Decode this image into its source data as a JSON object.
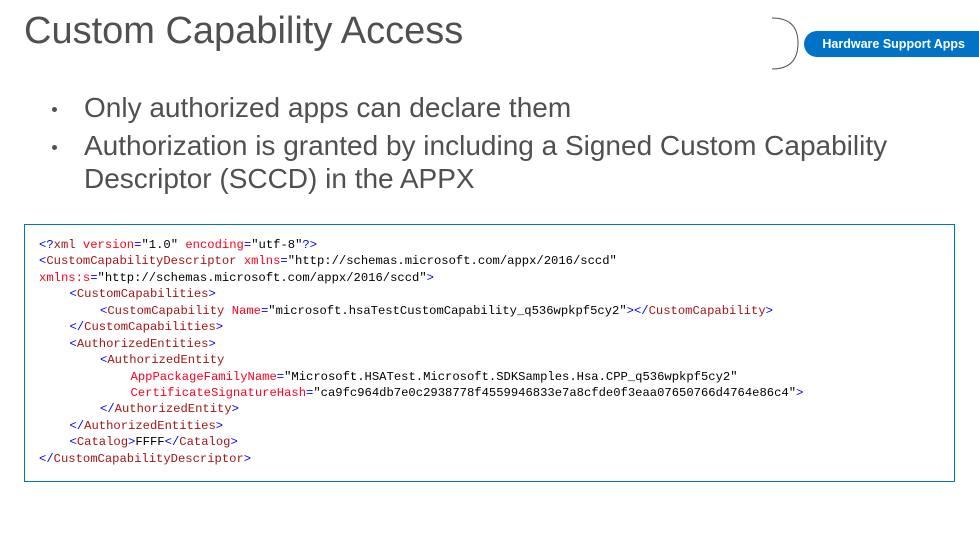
{
  "title": "Custom Capability Access",
  "badge": "Hardware Support Apps",
  "bullets": [
    "Only authorized apps can declare them",
    "Authorization is granted by including a Signed Custom Capability Descriptor (SCCD) in the APPX"
  ],
  "code": {
    "version_attr": "version",
    "version_val": "\"1.0\"",
    "encoding_attr": "encoding",
    "encoding_val": "\"utf-8\"",
    "root_tag": "CustomCapabilityDescriptor",
    "xmlns_attr": "xmlns",
    "xmlns_val": "\"http://schemas.microsoft.com/appx/2016/sccd\"",
    "xmlnss_attr": "xmlns:s",
    "xmlnss_val": "\"http://schemas.microsoft.com/appx/2016/sccd\"",
    "caps_tag": "CustomCapabilities",
    "cap_tag": "CustomCapability",
    "name_attr": "Name",
    "name_val": "\"microsoft.hsaTestCustomCapability_q536wpkpf5cy2\"",
    "auth_entities_tag": "AuthorizedEntities",
    "auth_entity_tag": "AuthorizedEntity",
    "pfn_attr": "AppPackageFamilyName",
    "pfn_val": "\"Microsoft.HSATest.Microsoft.SDKSamples.Hsa.CPP_q536wpkpf5cy2\"",
    "cert_attr": "CertificateSignatureHash",
    "cert_val": "\"ca9fc964db7e0c2938778f4559946833e7a8cfde0f3eaa07650766d4764e86c4\"",
    "catalog_tag": "Catalog",
    "catalog_val": "FFFF"
  }
}
